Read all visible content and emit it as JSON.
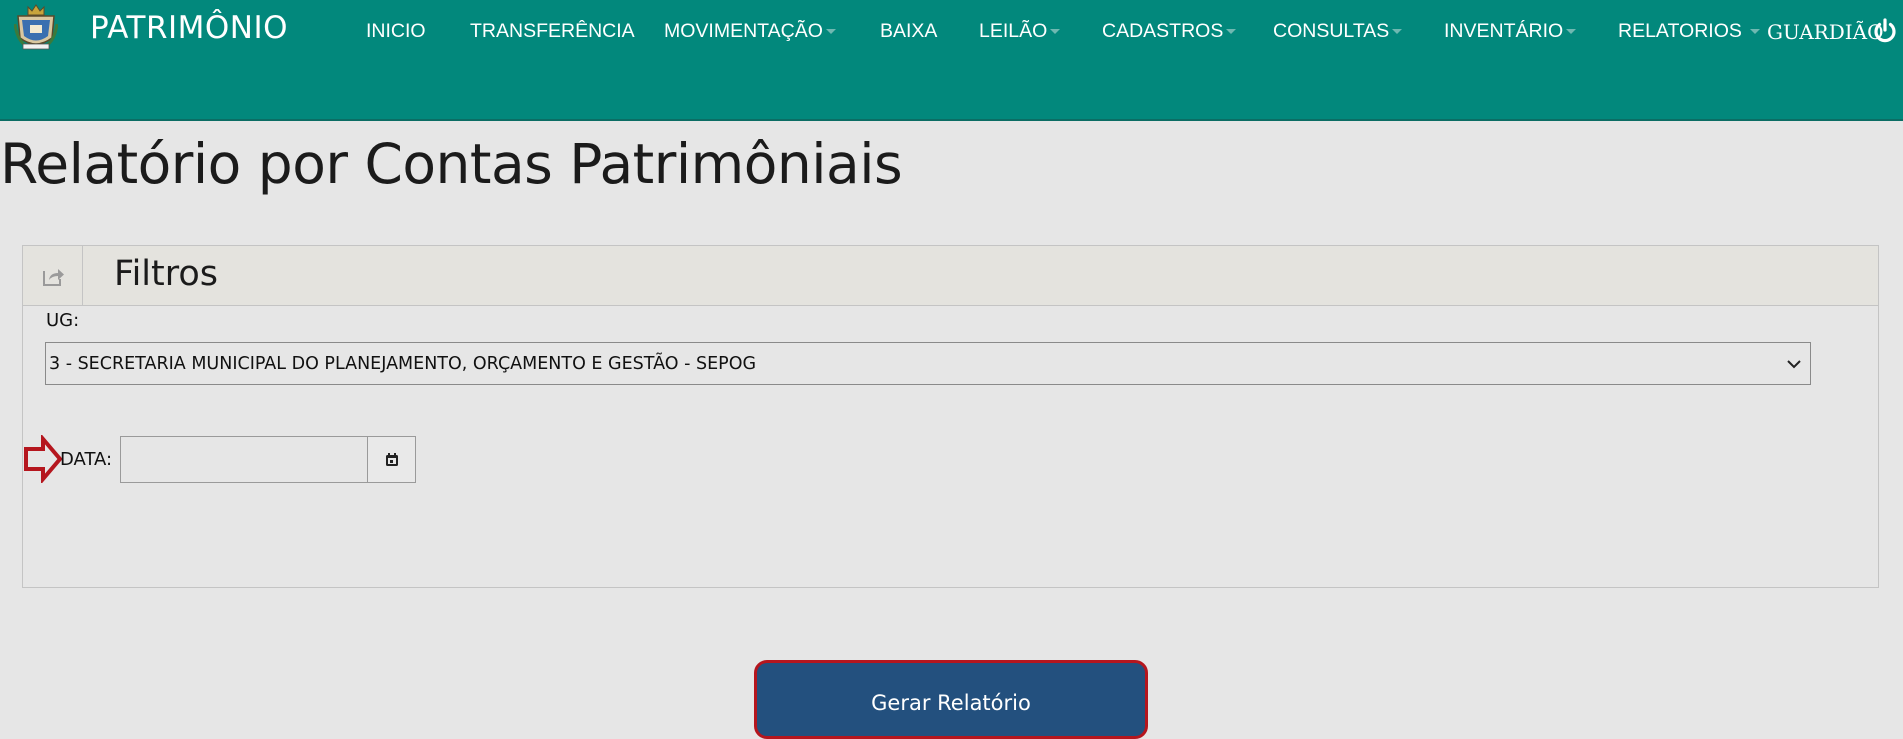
{
  "app": {
    "title": "PATRIMÔNIO",
    "logo_icon": "municipal-coat-of-arms-icon",
    "nav": [
      {
        "label": "INICIO",
        "dropdown": false
      },
      {
        "label": "TRANSFERÊNCIA",
        "dropdown": false
      },
      {
        "label": "MOVIMENTAÇÃO",
        "dropdown": true
      },
      {
        "label": "BAIXA",
        "dropdown": false
      },
      {
        "label": "LEILÃO",
        "dropdown": true
      },
      {
        "label": "CADASTROS",
        "dropdown": true
      },
      {
        "label": "CONSULTAS",
        "dropdown": true
      },
      {
        "label": "INVENTÁRIO",
        "dropdown": true
      },
      {
        "label": "RELATORIOS",
        "dropdown": true
      }
    ],
    "user": "GUARDIÃO",
    "logout_icon": "power-icon",
    "colors": {
      "navbar": "#02887c",
      "button": "#23507e",
      "highlight": "#b5161e"
    }
  },
  "page": {
    "title": "Relatório por Contas Patrimôniais"
  },
  "filters": {
    "panel_title": "Filtros",
    "panel_icon": "share-icon",
    "ug_label": "UG:",
    "ug_value": "3 - SECRETARIA MUNICIPAL DO PLANEJAMENTO, ORÇAMENTO E GESTÃO - SEPOG",
    "data_label": "DATA:",
    "data_value": "",
    "calendar_icon": "calendar-icon"
  },
  "actions": {
    "generate_label": "Gerar Relatório"
  }
}
